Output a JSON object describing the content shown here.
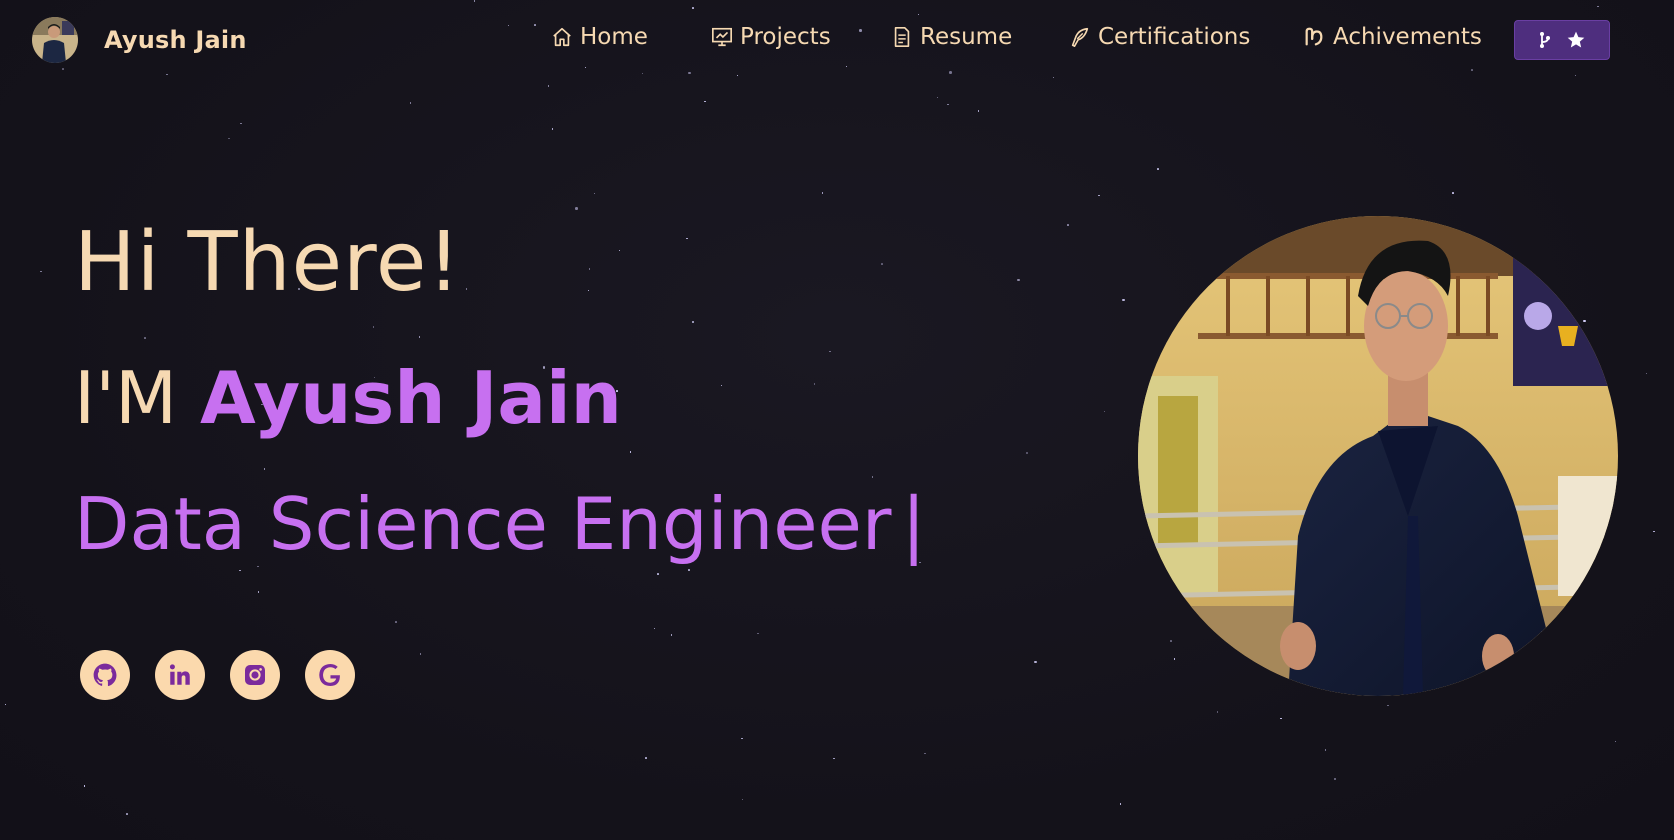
{
  "brand": {
    "name": "Ayush Jain"
  },
  "nav": {
    "items": [
      {
        "label": "Home",
        "icon": "home-icon"
      },
      {
        "label": "Projects",
        "icon": "projects-icon"
      },
      {
        "label": "Resume",
        "icon": "resume-icon"
      },
      {
        "label": "Certifications",
        "icon": "certifications-icon"
      },
      {
        "label": "Achivements",
        "icon": "achievements-icon"
      }
    ],
    "fork_button": {
      "icons": [
        "git-fork-icon",
        "star-icon"
      ]
    }
  },
  "hero": {
    "greeting": "Hi There!",
    "intro_prefix": "I'M ",
    "intro_name": "Ayush Jain",
    "role": "Data Science Engineer",
    "cursor": "|"
  },
  "socials": [
    {
      "icon": "github-icon"
    },
    {
      "icon": "linkedin-icon"
    },
    {
      "icon": "instagram-icon"
    },
    {
      "icon": "google-icon"
    }
  ],
  "colors": {
    "background": "#15131c",
    "accent": "#c770f0",
    "text": "#f6d9b2",
    "social_bg": "#fbd9ad",
    "button_bg": "#4e2e7e"
  }
}
